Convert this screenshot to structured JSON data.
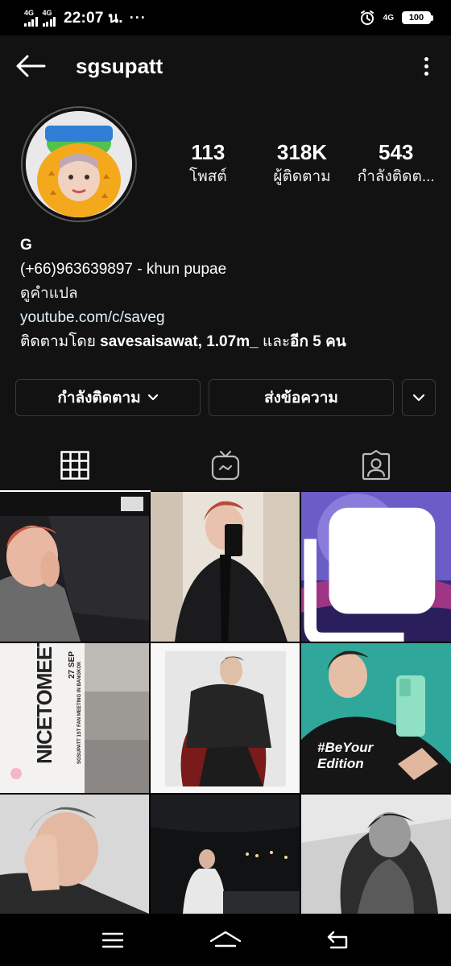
{
  "status_bar": {
    "sim1_label": "4G",
    "sim2_label": "4G",
    "time": "22:07 น.",
    "overflow": "···",
    "lte_label": "4G",
    "battery": "100"
  },
  "header": {
    "username": "sgsupatt",
    "back_icon": "back-arrow-icon",
    "more_icon": "more-vertical-icon"
  },
  "profile": {
    "stats": [
      {
        "value": "113",
        "label": "โพสต์"
      },
      {
        "value": "318K",
        "label": "ผู้ติดตาม"
      },
      {
        "value": "543",
        "label": "กำลังติดต..."
      }
    ],
    "bio": {
      "name": "G",
      "contact": "(+66)963639897 - khun pupae",
      "translate": "ดูคำแปล",
      "link": "youtube.com/c/saveg",
      "followed_by_prefix": "ติดตามโดย ",
      "followed_by_users": "savesaisawat, 1.07m_",
      "followed_by_middle": " และ",
      "followed_by_more": "อีก 5 คน"
    }
  },
  "actions": {
    "following_label": "กำลังติดตาม",
    "message_label": "ส่งข้อความ"
  },
  "tabs": [
    {
      "name": "grid-icon",
      "active": true
    },
    {
      "name": "igtv-icon",
      "active": false
    },
    {
      "name": "tagged-icon",
      "active": false
    }
  ],
  "grid": {
    "posts": [
      {
        "id": "post-1"
      },
      {
        "id": "post-2"
      },
      {
        "id": "post-3",
        "multi": true
      },
      {
        "id": "post-4",
        "text_1": "NICETOMEET",
        "text_2": "27 SEP",
        "text_3": "SGSUPATT 1ST FAN MEETING IN BANGKOK"
      },
      {
        "id": "post-5"
      },
      {
        "id": "post-6",
        "promo_1": "#BeYour",
        "promo_2": "Edition"
      },
      {
        "id": "post-7"
      },
      {
        "id": "post-8"
      },
      {
        "id": "post-9"
      }
    ]
  },
  "navbar": {
    "items": [
      "menu-icon",
      "home-icon",
      "back-icon"
    ]
  },
  "colors": {
    "background": "#121212",
    "text": "#ffffff",
    "link": "#e0f1ff",
    "border": "#3a3a3a"
  }
}
